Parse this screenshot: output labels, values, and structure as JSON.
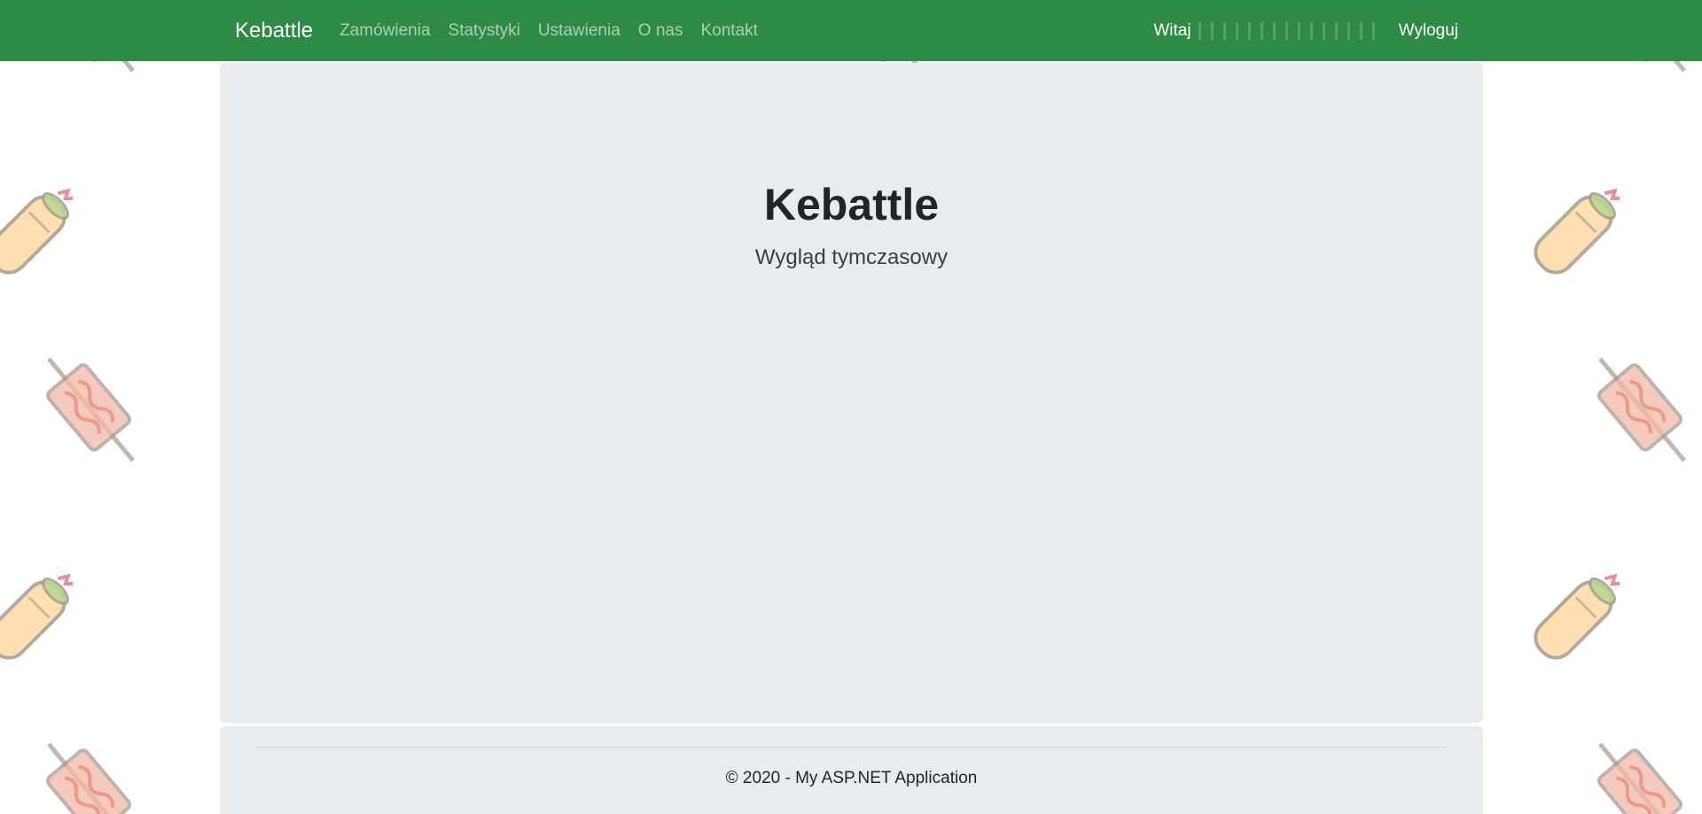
{
  "navbar": {
    "brand": "Kebattle",
    "links": [
      "Zamówienia",
      "Statystyki",
      "Ustawienia",
      "O nas",
      "Kontakt"
    ],
    "greeting": "Witaj",
    "logout": "Wyloguj"
  },
  "jumbotron": {
    "title": "Kebattle",
    "subtitle": "Wygląd tymczasowy"
  },
  "footer": {
    "text": "© 2020 - My ASP.NET Application"
  },
  "colors": {
    "navbar": "#2e8b45",
    "panel": "#e8ecef"
  },
  "background_icons": [
    "kebab-skewer-icon",
    "wrap-icon"
  ]
}
